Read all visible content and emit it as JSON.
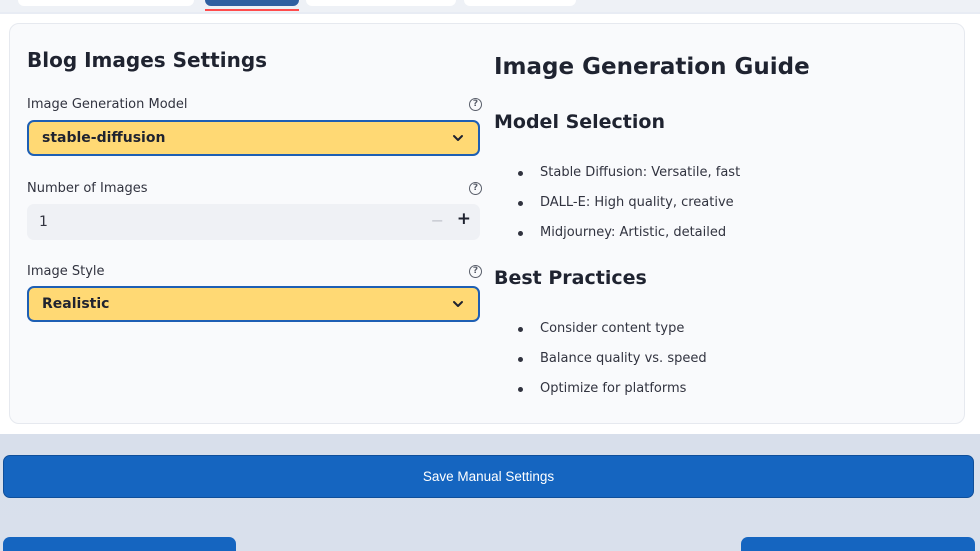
{
  "settings": {
    "title": "Blog Images Settings",
    "model": {
      "label": "Image Generation Model",
      "value": "stable-diffusion"
    },
    "count": {
      "label": "Number of Images",
      "value": "1"
    },
    "style": {
      "label": "Image Style",
      "value": "Realistic"
    }
  },
  "guide": {
    "title": "Image Generation Guide",
    "model_selection": {
      "title": "Model Selection",
      "items": [
        "Stable Diffusion: Versatile, fast",
        "DALL-E: High quality, creative",
        "Midjourney: Artistic, detailed"
      ]
    },
    "best_practices": {
      "title": "Best Practices",
      "items": [
        "Consider content type",
        "Balance quality vs. speed",
        "Optimize for platforms"
      ]
    }
  },
  "actions": {
    "save_label": "Save Manual Settings"
  },
  "icons": {
    "help": "help-circle-icon",
    "chevron": "chevron-down-icon",
    "minus": "minus-icon",
    "plus": "plus-icon"
  },
  "colors": {
    "accent": "#1565c0",
    "select_bg": "#ffd974",
    "tab_indicator": "#ff4b4b"
  }
}
